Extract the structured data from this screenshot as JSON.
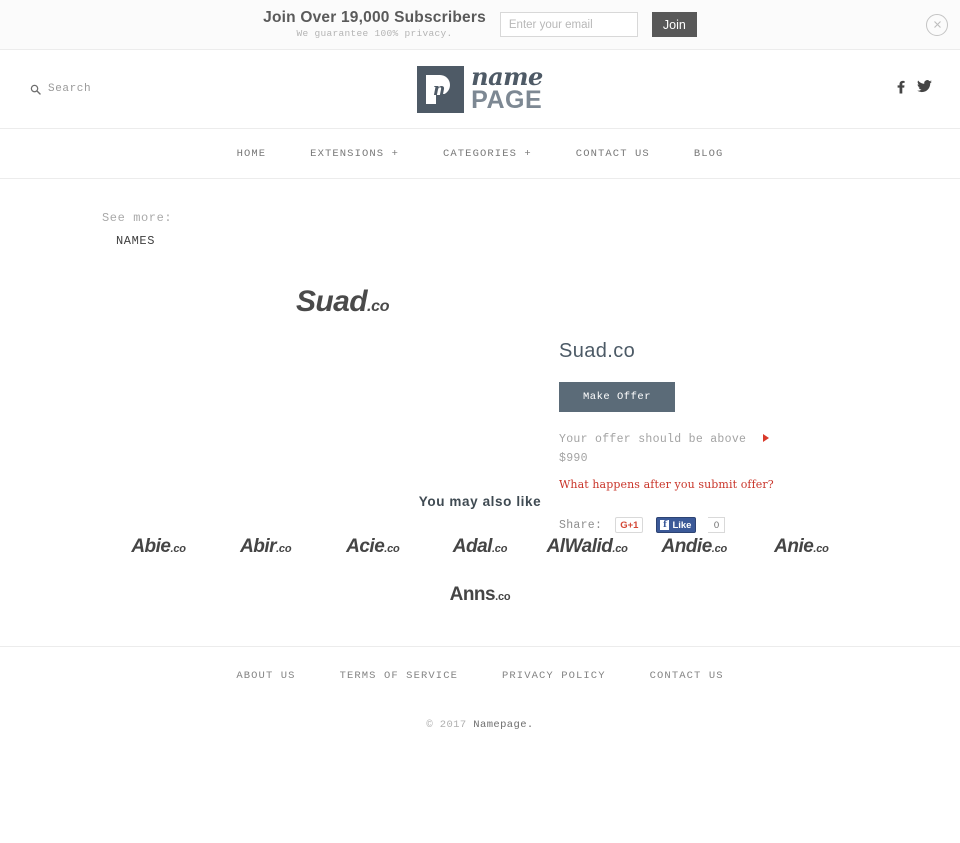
{
  "subscribe_bar": {
    "headline": "Join Over 19,000 Subscribers",
    "subline": "We guarantee 100% privacy.",
    "email_placeholder": "Enter your email",
    "email_value": "",
    "join_label": "Join",
    "close_icon": "close-circle-icon"
  },
  "header": {
    "search_label": "Search",
    "search_icon": "search-icon",
    "logo": {
      "mark_letter": "n",
      "name": "name",
      "page": "PAGE",
      "mark_color": "#4e5a66",
      "page_color": "#7d8893"
    },
    "social": [
      {
        "name": "facebook-icon",
        "label": "f"
      },
      {
        "name": "twitter-icon",
        "label": "t"
      }
    ]
  },
  "nav": {
    "items": [
      {
        "label": "HOME"
      },
      {
        "label": "EXTENSIONS +"
      },
      {
        "label": "CATEGORIES +"
      },
      {
        "label": "CONTACT US"
      },
      {
        "label": "BLOG"
      }
    ]
  },
  "breadcrumb": {
    "see_more_label": "See more:",
    "category": "NAMES"
  },
  "product": {
    "art_name": "Suad",
    "art_tld": ".co",
    "title": "Suad.co",
    "make_offer_label": "Make Offer",
    "offer_note": "Your offer should be above",
    "offer_price": "$990",
    "offer_link": "What happens after you submit offer?",
    "accent_red": "#c9352a",
    "button_color": "#5b6b78",
    "share": {
      "label": "Share:",
      "gplus_label": "G+1",
      "facebook_label": "Like",
      "facebook_count": "0"
    }
  },
  "also_like": {
    "heading": "You may also like",
    "items": [
      {
        "name": "Abie",
        "tld": ".co",
        "style": "italic"
      },
      {
        "name": "Abir",
        "tld": ".co",
        "style": "italic"
      },
      {
        "name": "Acie",
        "tld": ".co",
        "style": "italic"
      },
      {
        "name": "Adal",
        "tld": ".co",
        "style": "italic"
      },
      {
        "name": "AlWalid",
        "tld": ".co",
        "style": "italic"
      },
      {
        "name": "Andie",
        "tld": ".co",
        "style": "italic"
      },
      {
        "name": "Anie",
        "tld": ".co",
        "style": "italic"
      },
      {
        "name": "Anns",
        "tld": ".co",
        "style": "upright"
      }
    ]
  },
  "footer": {
    "links": [
      {
        "label": "ABOUT US"
      },
      {
        "label": "TERMS OF SERVICE"
      },
      {
        "label": "PRIVACY POLICY"
      },
      {
        "label": "CONTACT US"
      }
    ],
    "copyright_prefix": "© 2017 ",
    "copyright_brand": "Namepage."
  }
}
